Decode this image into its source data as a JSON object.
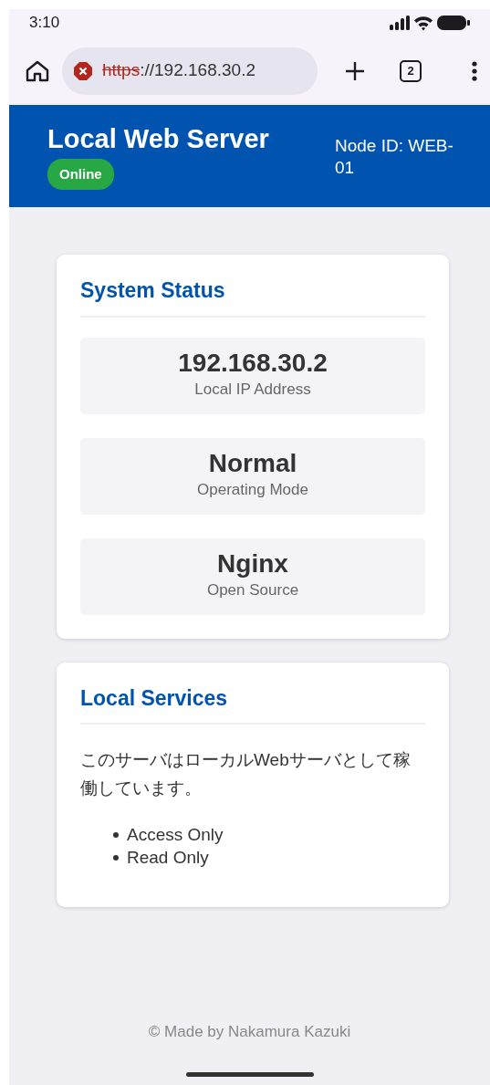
{
  "status_bar": {
    "time": "3:10"
  },
  "browser": {
    "url_scheme": "https",
    "url_rest": "://192.168.30.2",
    "insecure": true,
    "tab_count": "2"
  },
  "header": {
    "title": "Local Web Server",
    "badge": "Online",
    "node_id": "Node ID: WEB-01"
  },
  "cards": [
    {
      "title": "System Status",
      "kind": "stats",
      "stats": [
        {
          "value": "192.168.30.2",
          "label": "Local IP Address"
        },
        {
          "value": "Normal",
          "label": "Operating Mode"
        },
        {
          "value": "Nginx",
          "label": "Open Source"
        }
      ]
    },
    {
      "title": "Local Services",
      "kind": "text",
      "paragraph": "このサーバはローカルWebサーバとして稼働しています。",
      "items": [
        "Access Only",
        "Read Only"
      ]
    }
  ],
  "footer": "© Made by Nakamura Kazuki"
}
